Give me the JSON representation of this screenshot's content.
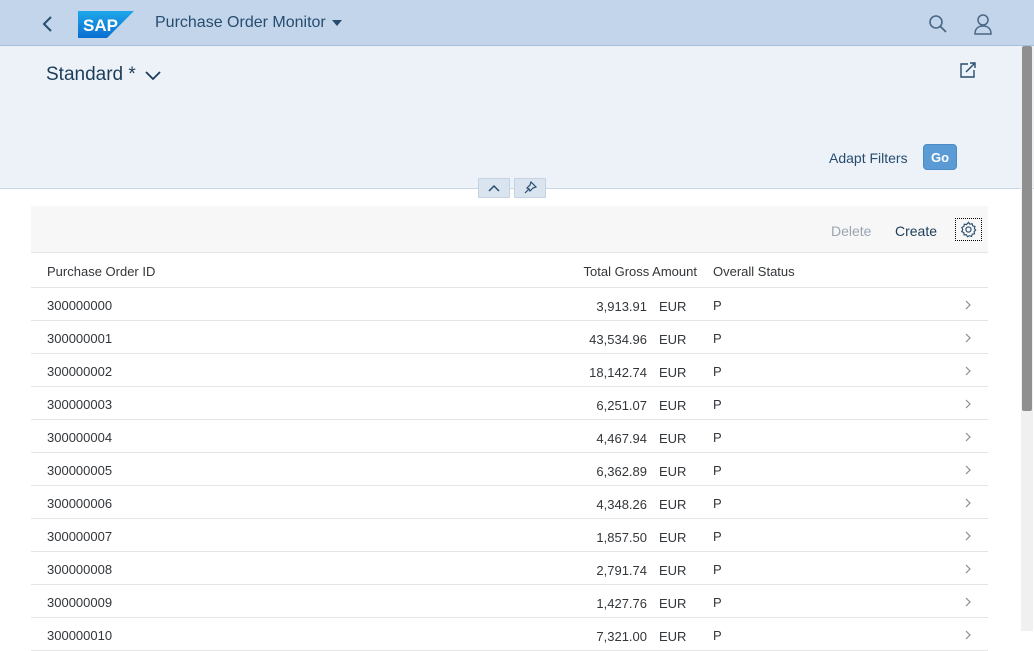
{
  "shell": {
    "logo_text": "SAP",
    "app_title": "Purchase Order Monitor"
  },
  "header": {
    "variant_name": "Standard *",
    "adapt_filters_label": "Adapt Filters",
    "go_label": "Go"
  },
  "toolbar": {
    "delete_label": "Delete",
    "create_label": "Create"
  },
  "table": {
    "columns": {
      "id": "Purchase Order ID",
      "amount": "Total Gross Amount",
      "status": "Overall Status"
    },
    "rows": [
      {
        "id": "300000000",
        "amount": "3,913.91",
        "currency": "EUR",
        "status": "P"
      },
      {
        "id": "300000001",
        "amount": "43,534.96",
        "currency": "EUR",
        "status": "P"
      },
      {
        "id": "300000002",
        "amount": "18,142.74",
        "currency": "EUR",
        "status": "P"
      },
      {
        "id": "300000003",
        "amount": "6,251.07",
        "currency": "EUR",
        "status": "P"
      },
      {
        "id": "300000004",
        "amount": "4,467.94",
        "currency": "EUR",
        "status": "P"
      },
      {
        "id": "300000005",
        "amount": "6,362.89",
        "currency": "EUR",
        "status": "P"
      },
      {
        "id": "300000006",
        "amount": "4,348.26",
        "currency": "EUR",
        "status": "P"
      },
      {
        "id": "300000007",
        "amount": "1,857.50",
        "currency": "EUR",
        "status": "P"
      },
      {
        "id": "300000008",
        "amount": "2,791.74",
        "currency": "EUR",
        "status": "P"
      },
      {
        "id": "300000009",
        "amount": "1,427.76",
        "currency": "EUR",
        "status": "P"
      },
      {
        "id": "300000010",
        "amount": "7,321.00",
        "currency": "EUR",
        "status": "P"
      }
    ]
  },
  "colors": {
    "shell_bg": "#c3d5ea",
    "header_bg": "#edf2f8",
    "go_button": "#5b9bd5",
    "title_text": "#274c6f"
  }
}
